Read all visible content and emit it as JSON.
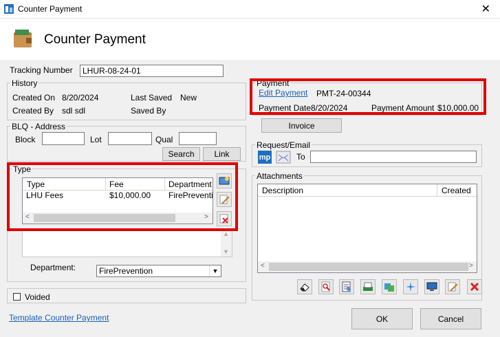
{
  "window": {
    "title": "Counter Payment"
  },
  "header": {
    "title": "Counter Payment"
  },
  "tracking": {
    "label": "Tracking Number",
    "value": "LHUR-08-24-01"
  },
  "history": {
    "group_title": "History",
    "created_on_label": "Created On",
    "created_on": "8/20/2024",
    "created_by_label": "Created By",
    "created_by": "sdl sdl",
    "last_saved_label": "Last Saved",
    "last_saved": "New",
    "saved_by_label": "Saved By"
  },
  "blq": {
    "group_title": "BLQ - Address",
    "block_label": "Block",
    "lot_label": "Lot",
    "qual_label": "Qual",
    "search_label": "Search",
    "link_label": "Link"
  },
  "type": {
    "group_title": "Type",
    "columns": [
      "Type",
      "Fee",
      "Department"
    ],
    "rows": [
      {
        "type": "LHU Fees",
        "fee": "$10,000.00",
        "department": "FirePrevention"
      }
    ]
  },
  "department": {
    "label": "Department:",
    "value": "FirePrevention"
  },
  "voided": {
    "label": "Voided"
  },
  "template_link": "Template Counter Payment",
  "payment": {
    "group_title": "Payment",
    "edit_link": "Edit Payment",
    "number": "PMT-24-00344",
    "date_label": "Payment Date",
    "date": "8/20/2024",
    "amount_label": "Payment Amount",
    "amount": "$10,000.00"
  },
  "invoice_label": "Invoice",
  "request": {
    "group_title": "Request/Email",
    "to_label": "To",
    "mp_label": "mp"
  },
  "attachments": {
    "group_title": "Attachments",
    "columns": [
      "Description",
      "Created"
    ]
  },
  "ok_label": "OK",
  "cancel_label": "Cancel",
  "colors": {
    "highlight": "#e00000",
    "link": "#1a5fb4"
  }
}
